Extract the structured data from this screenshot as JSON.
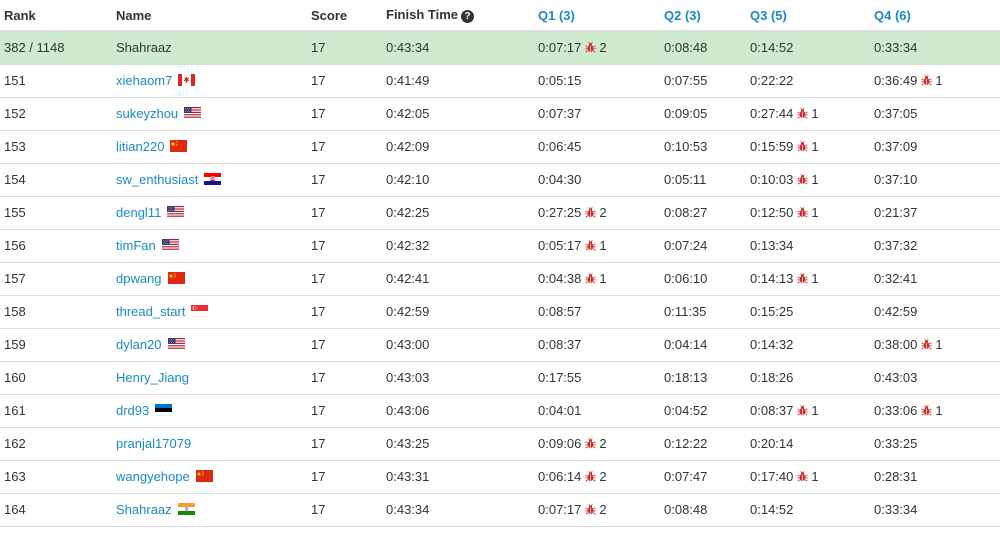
{
  "headers": {
    "rank": "Rank",
    "name": "Name",
    "score": "Score",
    "finish_time": "Finish Time",
    "q1": "Q1 (3)",
    "q2": "Q2 (3)",
    "q3": "Q3 (5)",
    "q4": "Q4 (6)"
  },
  "colors": {
    "link": "#1a8ac6",
    "self_row_bg": "#d0ead0",
    "bug": "#c9302c"
  },
  "rows": [
    {
      "rank": "382 / 1148",
      "name": "Shahraaz",
      "self": true,
      "flag": "",
      "score": "17",
      "finish": "0:43:34",
      "q1": {
        "time": "0:07:17",
        "wrong": "2"
      },
      "q2": {
        "time": "0:08:48",
        "wrong": ""
      },
      "q3": {
        "time": "0:14:52",
        "wrong": ""
      },
      "q4": {
        "time": "0:33:34",
        "wrong": ""
      }
    },
    {
      "rank": "151",
      "name": "xiehaom7",
      "flag": "canada-flag-icon",
      "score": "17",
      "finish": "0:41:49",
      "q1": {
        "time": "0:05:15",
        "wrong": ""
      },
      "q2": {
        "time": "0:07:55",
        "wrong": ""
      },
      "q3": {
        "time": "0:22:22",
        "wrong": ""
      },
      "q4": {
        "time": "0:36:49",
        "wrong": "1"
      }
    },
    {
      "rank": "152",
      "name": "sukeyzhou",
      "flag": "usa-flag-icon",
      "score": "17",
      "finish": "0:42:05",
      "q1": {
        "time": "0:07:37",
        "wrong": ""
      },
      "q2": {
        "time": "0:09:05",
        "wrong": ""
      },
      "q3": {
        "time": "0:27:44",
        "wrong": "1"
      },
      "q4": {
        "time": "0:37:05",
        "wrong": ""
      }
    },
    {
      "rank": "153",
      "name": "litian220",
      "flag": "china-flag-icon",
      "score": "17",
      "finish": "0:42:09",
      "q1": {
        "time": "0:06:45",
        "wrong": ""
      },
      "q2": {
        "time": "0:10:53",
        "wrong": ""
      },
      "q3": {
        "time": "0:15:59",
        "wrong": "1"
      },
      "q4": {
        "time": "0:37:09",
        "wrong": ""
      }
    },
    {
      "rank": "154",
      "name": "sw_enthusiast",
      "flag": "croatia-flag-icon",
      "score": "17",
      "finish": "0:42:10",
      "q1": {
        "time": "0:04:30",
        "wrong": ""
      },
      "q2": {
        "time": "0:05:11",
        "wrong": ""
      },
      "q3": {
        "time": "0:10:03",
        "wrong": "1"
      },
      "q4": {
        "time": "0:37:10",
        "wrong": ""
      }
    },
    {
      "rank": "155",
      "name": "dengl11",
      "flag": "usa-flag-icon",
      "score": "17",
      "finish": "0:42:25",
      "q1": {
        "time": "0:27:25",
        "wrong": "2"
      },
      "q2": {
        "time": "0:08:27",
        "wrong": ""
      },
      "q3": {
        "time": "0:12:50",
        "wrong": "1"
      },
      "q4": {
        "time": "0:21:37",
        "wrong": ""
      }
    },
    {
      "rank": "156",
      "name": "timFan",
      "flag": "usa-flag-icon",
      "score": "17",
      "finish": "0:42:32",
      "q1": {
        "time": "0:05:17",
        "wrong": "1"
      },
      "q2": {
        "time": "0:07:24",
        "wrong": ""
      },
      "q3": {
        "time": "0:13:34",
        "wrong": ""
      },
      "q4": {
        "time": "0:37:32",
        "wrong": ""
      }
    },
    {
      "rank": "157",
      "name": "dpwang",
      "flag": "china-flag-icon",
      "score": "17",
      "finish": "0:42:41",
      "q1": {
        "time": "0:04:38",
        "wrong": "1"
      },
      "q2": {
        "time": "0:06:10",
        "wrong": ""
      },
      "q3": {
        "time": "0:14:13",
        "wrong": "1"
      },
      "q4": {
        "time": "0:32:41",
        "wrong": ""
      }
    },
    {
      "rank": "158",
      "name": "thread_start",
      "flag": "singapore-flag-icon",
      "score": "17",
      "finish": "0:42:59",
      "q1": {
        "time": "0:08:57",
        "wrong": ""
      },
      "q2": {
        "time": "0:11:35",
        "wrong": ""
      },
      "q3": {
        "time": "0:15:25",
        "wrong": ""
      },
      "q4": {
        "time": "0:42:59",
        "wrong": ""
      }
    },
    {
      "rank": "159",
      "name": "dylan20",
      "flag": "usa-flag-icon",
      "score": "17",
      "finish": "0:43:00",
      "q1": {
        "time": "0:08:37",
        "wrong": ""
      },
      "q2": {
        "time": "0:04:14",
        "wrong": ""
      },
      "q3": {
        "time": "0:14:32",
        "wrong": ""
      },
      "q4": {
        "time": "0:38:00",
        "wrong": "1"
      }
    },
    {
      "rank": "160",
      "name": "Henry_Jiang",
      "flag": "",
      "score": "17",
      "finish": "0:43:03",
      "q1": {
        "time": "0:17:55",
        "wrong": ""
      },
      "q2": {
        "time": "0:18:13",
        "wrong": ""
      },
      "q3": {
        "time": "0:18:26",
        "wrong": ""
      },
      "q4": {
        "time": "0:43:03",
        "wrong": ""
      }
    },
    {
      "rank": "161",
      "name": "drd93",
      "flag": "estonia-flag-icon",
      "score": "17",
      "finish": "0:43:06",
      "q1": {
        "time": "0:04:01",
        "wrong": ""
      },
      "q2": {
        "time": "0:04:52",
        "wrong": ""
      },
      "q3": {
        "time": "0:08:37",
        "wrong": "1"
      },
      "q4": {
        "time": "0:33:06",
        "wrong": "1"
      }
    },
    {
      "rank": "162",
      "name": "pranjal17079",
      "flag": "",
      "score": "17",
      "finish": "0:43:25",
      "q1": {
        "time": "0:09:06",
        "wrong": "2"
      },
      "q2": {
        "time": "0:12:22",
        "wrong": ""
      },
      "q3": {
        "time": "0:20:14",
        "wrong": ""
      },
      "q4": {
        "time": "0:33:25",
        "wrong": ""
      }
    },
    {
      "rank": "163",
      "name": "wangyehope",
      "flag": "china-flag-icon",
      "score": "17",
      "finish": "0:43:31",
      "q1": {
        "time": "0:06:14",
        "wrong": "2"
      },
      "q2": {
        "time": "0:07:47",
        "wrong": ""
      },
      "q3": {
        "time": "0:17:40",
        "wrong": "1"
      },
      "q4": {
        "time": "0:28:31",
        "wrong": ""
      }
    },
    {
      "rank": "164",
      "name": "Shahraaz",
      "flag": "india-flag-icon",
      "score": "17",
      "finish": "0:43:34",
      "q1": {
        "time": "0:07:17",
        "wrong": "2"
      },
      "q2": {
        "time": "0:08:48",
        "wrong": ""
      },
      "q3": {
        "time": "0:14:52",
        "wrong": ""
      },
      "q4": {
        "time": "0:33:34",
        "wrong": ""
      }
    }
  ]
}
